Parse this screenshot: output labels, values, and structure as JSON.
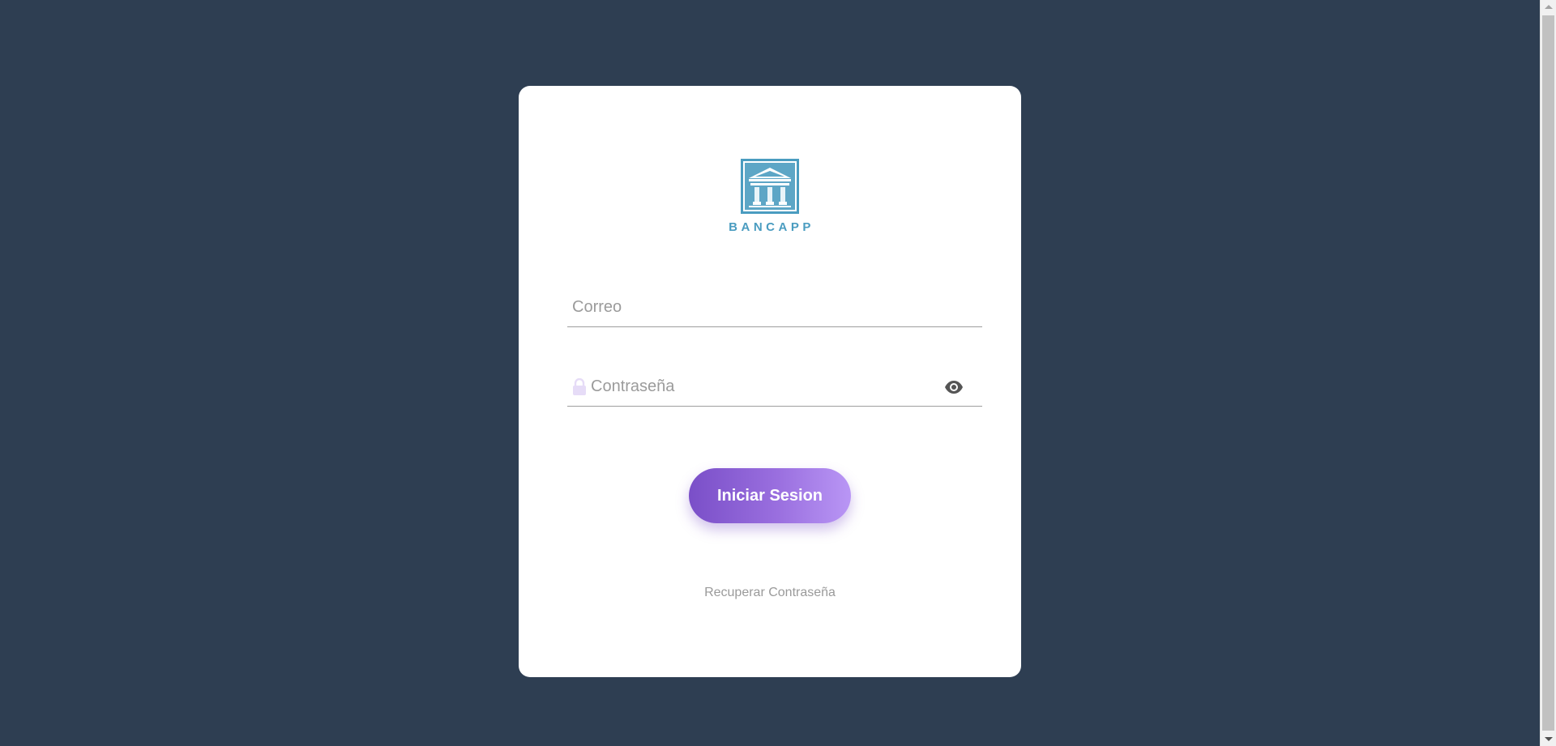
{
  "brand": {
    "name": "BANCAPP",
    "logo_icon": "bank-building-icon",
    "color": "#4a9cc0"
  },
  "login": {
    "email_placeholder": "Correo",
    "email_value": "",
    "password_placeholder": "Contraseña",
    "password_value": "",
    "lock_icon": "lock-icon",
    "toggle_visibility_icon": "eye-icon",
    "submit_label": "Iniciar Sesion",
    "recover_label": "Recuperar Contraseña"
  },
  "colors": {
    "background": "#2e3e52",
    "card": "#ffffff",
    "button_gradient_start": "#7a4fc8",
    "button_gradient_end": "#b996f5",
    "lock_icon": "#e6dcf7"
  }
}
